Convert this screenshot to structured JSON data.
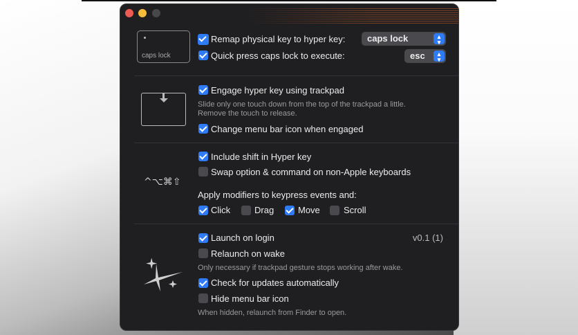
{
  "section1": {
    "key_preview_label": "caps lock",
    "remap": {
      "label": "Remap physical key to hyper key:",
      "checked": true,
      "value": "caps lock"
    },
    "quick": {
      "label": "Quick press caps lock to execute:",
      "checked": true,
      "value": "esc"
    }
  },
  "section2": {
    "engage": {
      "label": "Engage hyper key using trackpad",
      "checked": true
    },
    "engage_desc": [
      "Slide only one touch down from the top of the trackpad a little.",
      "Remove the touch to release."
    ],
    "menu_icon": {
      "label": "Change menu bar icon when engaged",
      "checked": true
    }
  },
  "section3": {
    "modifier_symbols": "^⌥⌘⇧",
    "shift": {
      "label": "Include shift in Hyper key",
      "checked": true
    },
    "swap": {
      "label": "Swap option & command on non-Apple keyboards",
      "checked": false
    },
    "apply_label": "Apply modifiers to keypress events and:",
    "events": [
      {
        "label": "Click",
        "checked": true
      },
      {
        "label": "Drag",
        "checked": false
      },
      {
        "label": "Move",
        "checked": true
      },
      {
        "label": "Scroll",
        "checked": false
      }
    ]
  },
  "section4": {
    "version": "v0.1 (1)",
    "launch": {
      "label": "Launch on login",
      "checked": true
    },
    "relaunch": {
      "label": "Relaunch on wake",
      "checked": false
    },
    "relaunch_desc": "Only necessary if trackpad gesture stops working after wake.",
    "updates": {
      "label": "Check for updates automatically",
      "checked": true
    },
    "hide": {
      "label": "Hide menu bar icon",
      "checked": false
    },
    "hide_desc": "When hidden, relaunch from Finder to open."
  }
}
